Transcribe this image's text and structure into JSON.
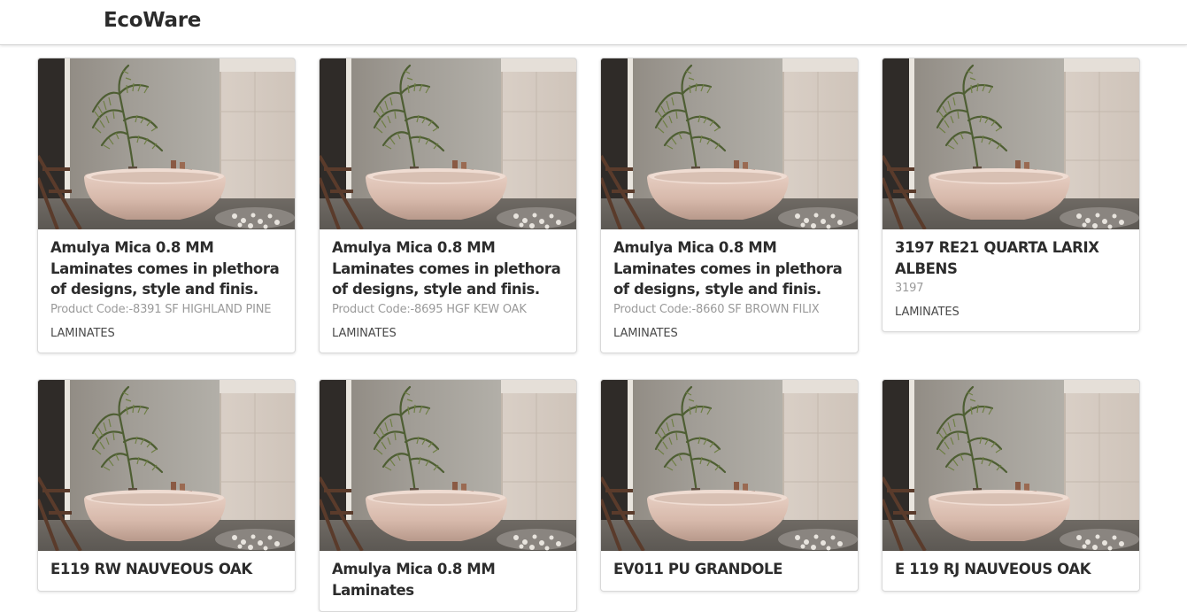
{
  "header": {
    "brand": "EcoWare"
  },
  "products": [
    {
      "title": "Amulya Mica 0.8 MM Laminates comes in plethora of designs, style and finis.",
      "code": "Product Code:-8391 SF HIGHLAND PINE",
      "category": "LAMINATES"
    },
    {
      "title": "Amulya Mica 0.8 MM Laminates comes in plethora of designs, style and finis.",
      "code": "Product Code:-8695 HGF KEW OAK",
      "category": "LAMINATES"
    },
    {
      "title": "Amulya Mica 0.8 MM Laminates comes in plethora of designs, style and finis.",
      "code": "Product Code:-8660 SF BROWN FILIX",
      "category": "LAMINATES"
    },
    {
      "title": "3197 RE21 QUARTA LARIX ALBENS",
      "code": "3197",
      "category": "LAMINATES"
    },
    {
      "title": "E119 RW NAUVEOUS OAK",
      "code": "",
      "category": ""
    },
    {
      "title": "Amulya Mica 0.8 MM Laminates",
      "code": "",
      "category": ""
    },
    {
      "title": "EV011 PU GRANDOLE",
      "code": "",
      "category": ""
    },
    {
      "title": "E 119 RJ NAUVEOUS OAK",
      "code": "",
      "category": ""
    }
  ],
  "product_image": {
    "alt": "bathroom-bathtub-image"
  }
}
